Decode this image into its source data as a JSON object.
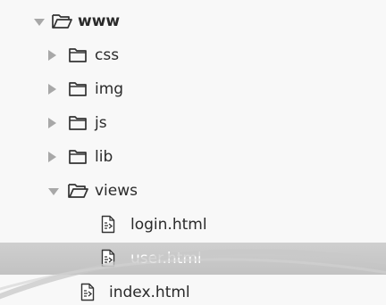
{
  "file_tree": {
    "root": {
      "label": "www",
      "expanded": true
    },
    "folders": [
      {
        "label": "css",
        "expanded": false
      },
      {
        "label": "img",
        "expanded": false
      },
      {
        "label": "js",
        "expanded": false
      },
      {
        "label": "lib",
        "expanded": false
      },
      {
        "label": "views",
        "expanded": true
      }
    ],
    "view_files": [
      {
        "label": "login.html",
        "selected": false
      },
      {
        "label": "user.html",
        "selected": true
      }
    ],
    "root_files": [
      {
        "label": "index.html"
      }
    ]
  },
  "icons": {
    "folder_open": "folder-open-icon",
    "folder_closed": "folder-icon",
    "file": "html-file-icon",
    "expanded": "triangle-down-icon",
    "collapsed": "triangle-right-icon"
  },
  "colors": {
    "background": "#f8f8f8",
    "text": "#2a2a2a",
    "arrow": "#a8a8a8",
    "selection": "#c7c7c7",
    "selected_text": "#ffffff"
  }
}
